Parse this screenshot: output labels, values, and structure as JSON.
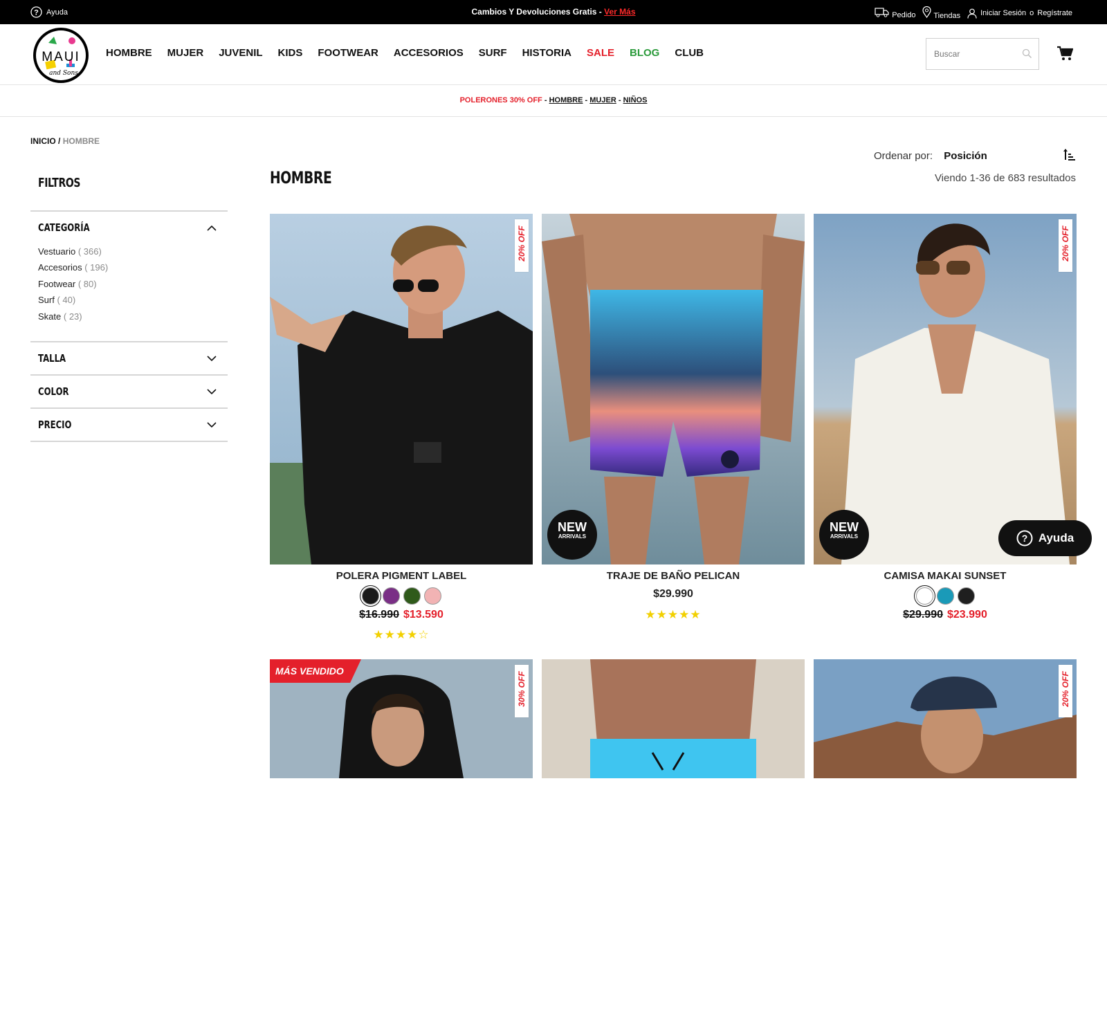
{
  "topbar": {
    "help_label": "Ayuda",
    "promo_text": "Cambios Y Devoluciones Gratis - ",
    "promo_link": "Ver Más",
    "order_label": "Pedido",
    "stores_label": "Tiendas",
    "login_label": "Iniciar Sesión",
    "or_label": "o",
    "register_label": "Regístrate"
  },
  "header": {
    "logo_text": "MAUI and Sons",
    "nav": [
      "HOMBRE",
      "MUJER",
      "JUVENIL",
      "KIDS",
      "FOOTWEAR",
      "ACCESORIOS",
      "SURF",
      "HISTORIA",
      "SALE",
      "BLOG",
      "CLUB"
    ],
    "search_placeholder": "Buscar"
  },
  "strip": {
    "promo": "POLERONES 30% OFF",
    "sep": "-",
    "links": [
      "HOMBRE",
      "MUJER",
      "NIÑOS"
    ]
  },
  "breadcrumb": {
    "home": "INICIO",
    "sep": "/",
    "current": "HOMBRE"
  },
  "sidebar": {
    "title": "FILTROS",
    "category": {
      "label": "CATEGORÍA",
      "items": [
        {
          "name": "Vestuario",
          "count": "( 366)"
        },
        {
          "name": "Accesorios",
          "count": "( 196)"
        },
        {
          "name": "Footwear",
          "count": "( 80)"
        },
        {
          "name": "Surf",
          "count": "( 40)"
        },
        {
          "name": "Skate",
          "count": "( 23)"
        }
      ]
    },
    "facets": [
      "TALLA",
      "COLOR",
      "PRECIO"
    ]
  },
  "main": {
    "title": "HOMBRE",
    "sort_label": "Ordenar por:",
    "sort_value": "Posición",
    "results": "Viendo 1-36 de 683 resultados"
  },
  "products": [
    {
      "name": "POLERA PIGMENT LABEL",
      "badge": "20% OFF",
      "old_price": "$16.990",
      "price": "$13.590",
      "rating": "★★★★☆",
      "swatches": [
        "#1a1a1a",
        "#7a2f86",
        "#2f5a1a",
        "#f2b3b4"
      ]
    },
    {
      "name": "TRAJE DE BAÑO PELICAN",
      "new_badge_1": "NEW",
      "new_badge_2": "ARRIVALS",
      "price": "$29.990",
      "rating": "★★★★★"
    },
    {
      "name": "CAMISA MAKAI SUNSET",
      "badge": "20% OFF",
      "new_badge_1": "NEW",
      "new_badge_2": "ARRIVALS",
      "old_price": "$29.990",
      "price": "$23.990",
      "swatches": [
        "#ffffff",
        "#1a9ab8",
        "#1f1f1f"
      ]
    },
    {
      "label": "MÁS VENDIDO",
      "badge": "30% OFF"
    },
    {},
    {
      "badge": "20% OFF"
    }
  ],
  "help_button": "Ayuda"
}
